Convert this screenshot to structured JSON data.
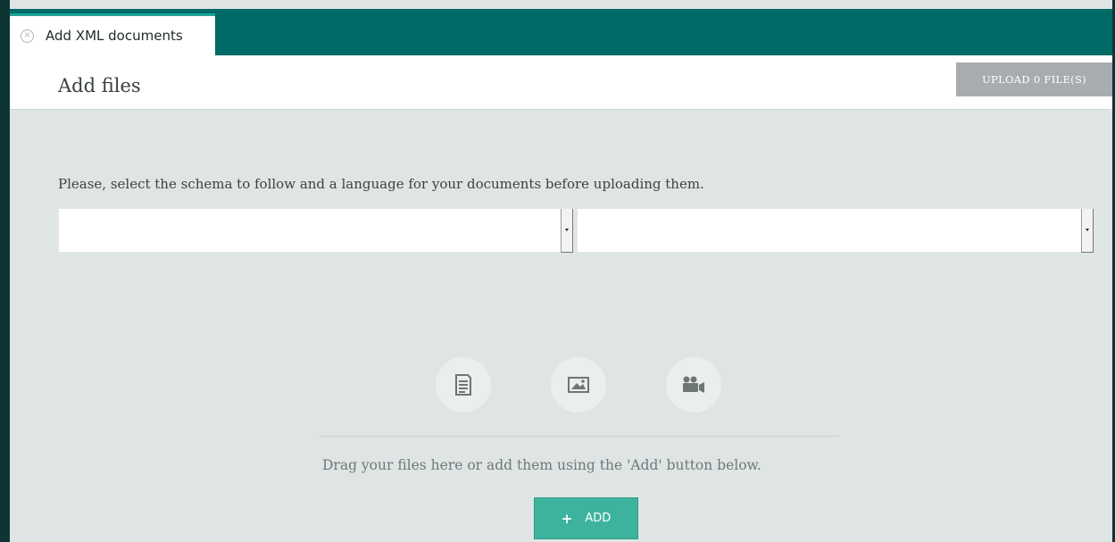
{
  "tab": {
    "label": "Add XML documents",
    "close_glyph": "×"
  },
  "header": {
    "title": "Add files",
    "upload_label": "UPLOAD 0 FILE(S)"
  },
  "form": {
    "instructions": "Please, select the schema to follow and a language for your documents before uploading them.",
    "schema_select_value": "",
    "language_select_value": ""
  },
  "dropzone": {
    "icons": [
      "document-icon",
      "image-icon",
      "video-icon"
    ],
    "text": "Drag your files here or add them using the 'Add' button below.",
    "add_label": "ADD",
    "add_icon": "+"
  },
  "colors": {
    "tabbar": "#006b66",
    "tab_accent": "#20a398",
    "add_button": "#3db39e",
    "upload_button": "#a7acb0",
    "background": "#dfe4e4"
  }
}
